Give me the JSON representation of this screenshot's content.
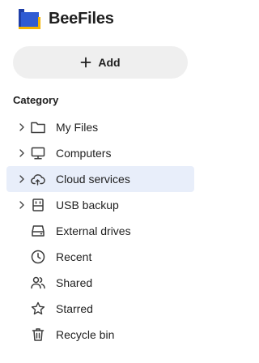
{
  "app": {
    "title": "BeeFiles",
    "logo_icon": "beefiles-logo-icon",
    "brand_colors": {
      "blue": "#2f5bd3",
      "yellow": "#f4b400"
    }
  },
  "add_button": {
    "label": "Add",
    "icon": "plus-icon"
  },
  "category": {
    "heading": "Category",
    "items": [
      {
        "label": "My Files",
        "icon": "folder-icon",
        "expandable": true,
        "active": false
      },
      {
        "label": "Computers",
        "icon": "computer-icon",
        "expandable": true,
        "active": false
      },
      {
        "label": "Cloud services",
        "icon": "cloud-sync-icon",
        "expandable": true,
        "active": true
      },
      {
        "label": "USB backup",
        "icon": "usb-icon",
        "expandable": true,
        "active": false
      },
      {
        "label": "External drives",
        "icon": "drive-icon",
        "expandable": false,
        "active": false
      },
      {
        "label": "Recent",
        "icon": "clock-icon",
        "expandable": false,
        "active": false
      },
      {
        "label": "Shared",
        "icon": "people-icon",
        "expandable": false,
        "active": false
      },
      {
        "label": "Starred",
        "icon": "star-icon",
        "expandable": false,
        "active": false
      },
      {
        "label": "Recycle bin",
        "icon": "trash-icon",
        "expandable": false,
        "active": false
      }
    ]
  },
  "colors": {
    "active_background": "#e8eefa",
    "add_button_background": "#efefef",
    "text": "#1f1f1f"
  }
}
